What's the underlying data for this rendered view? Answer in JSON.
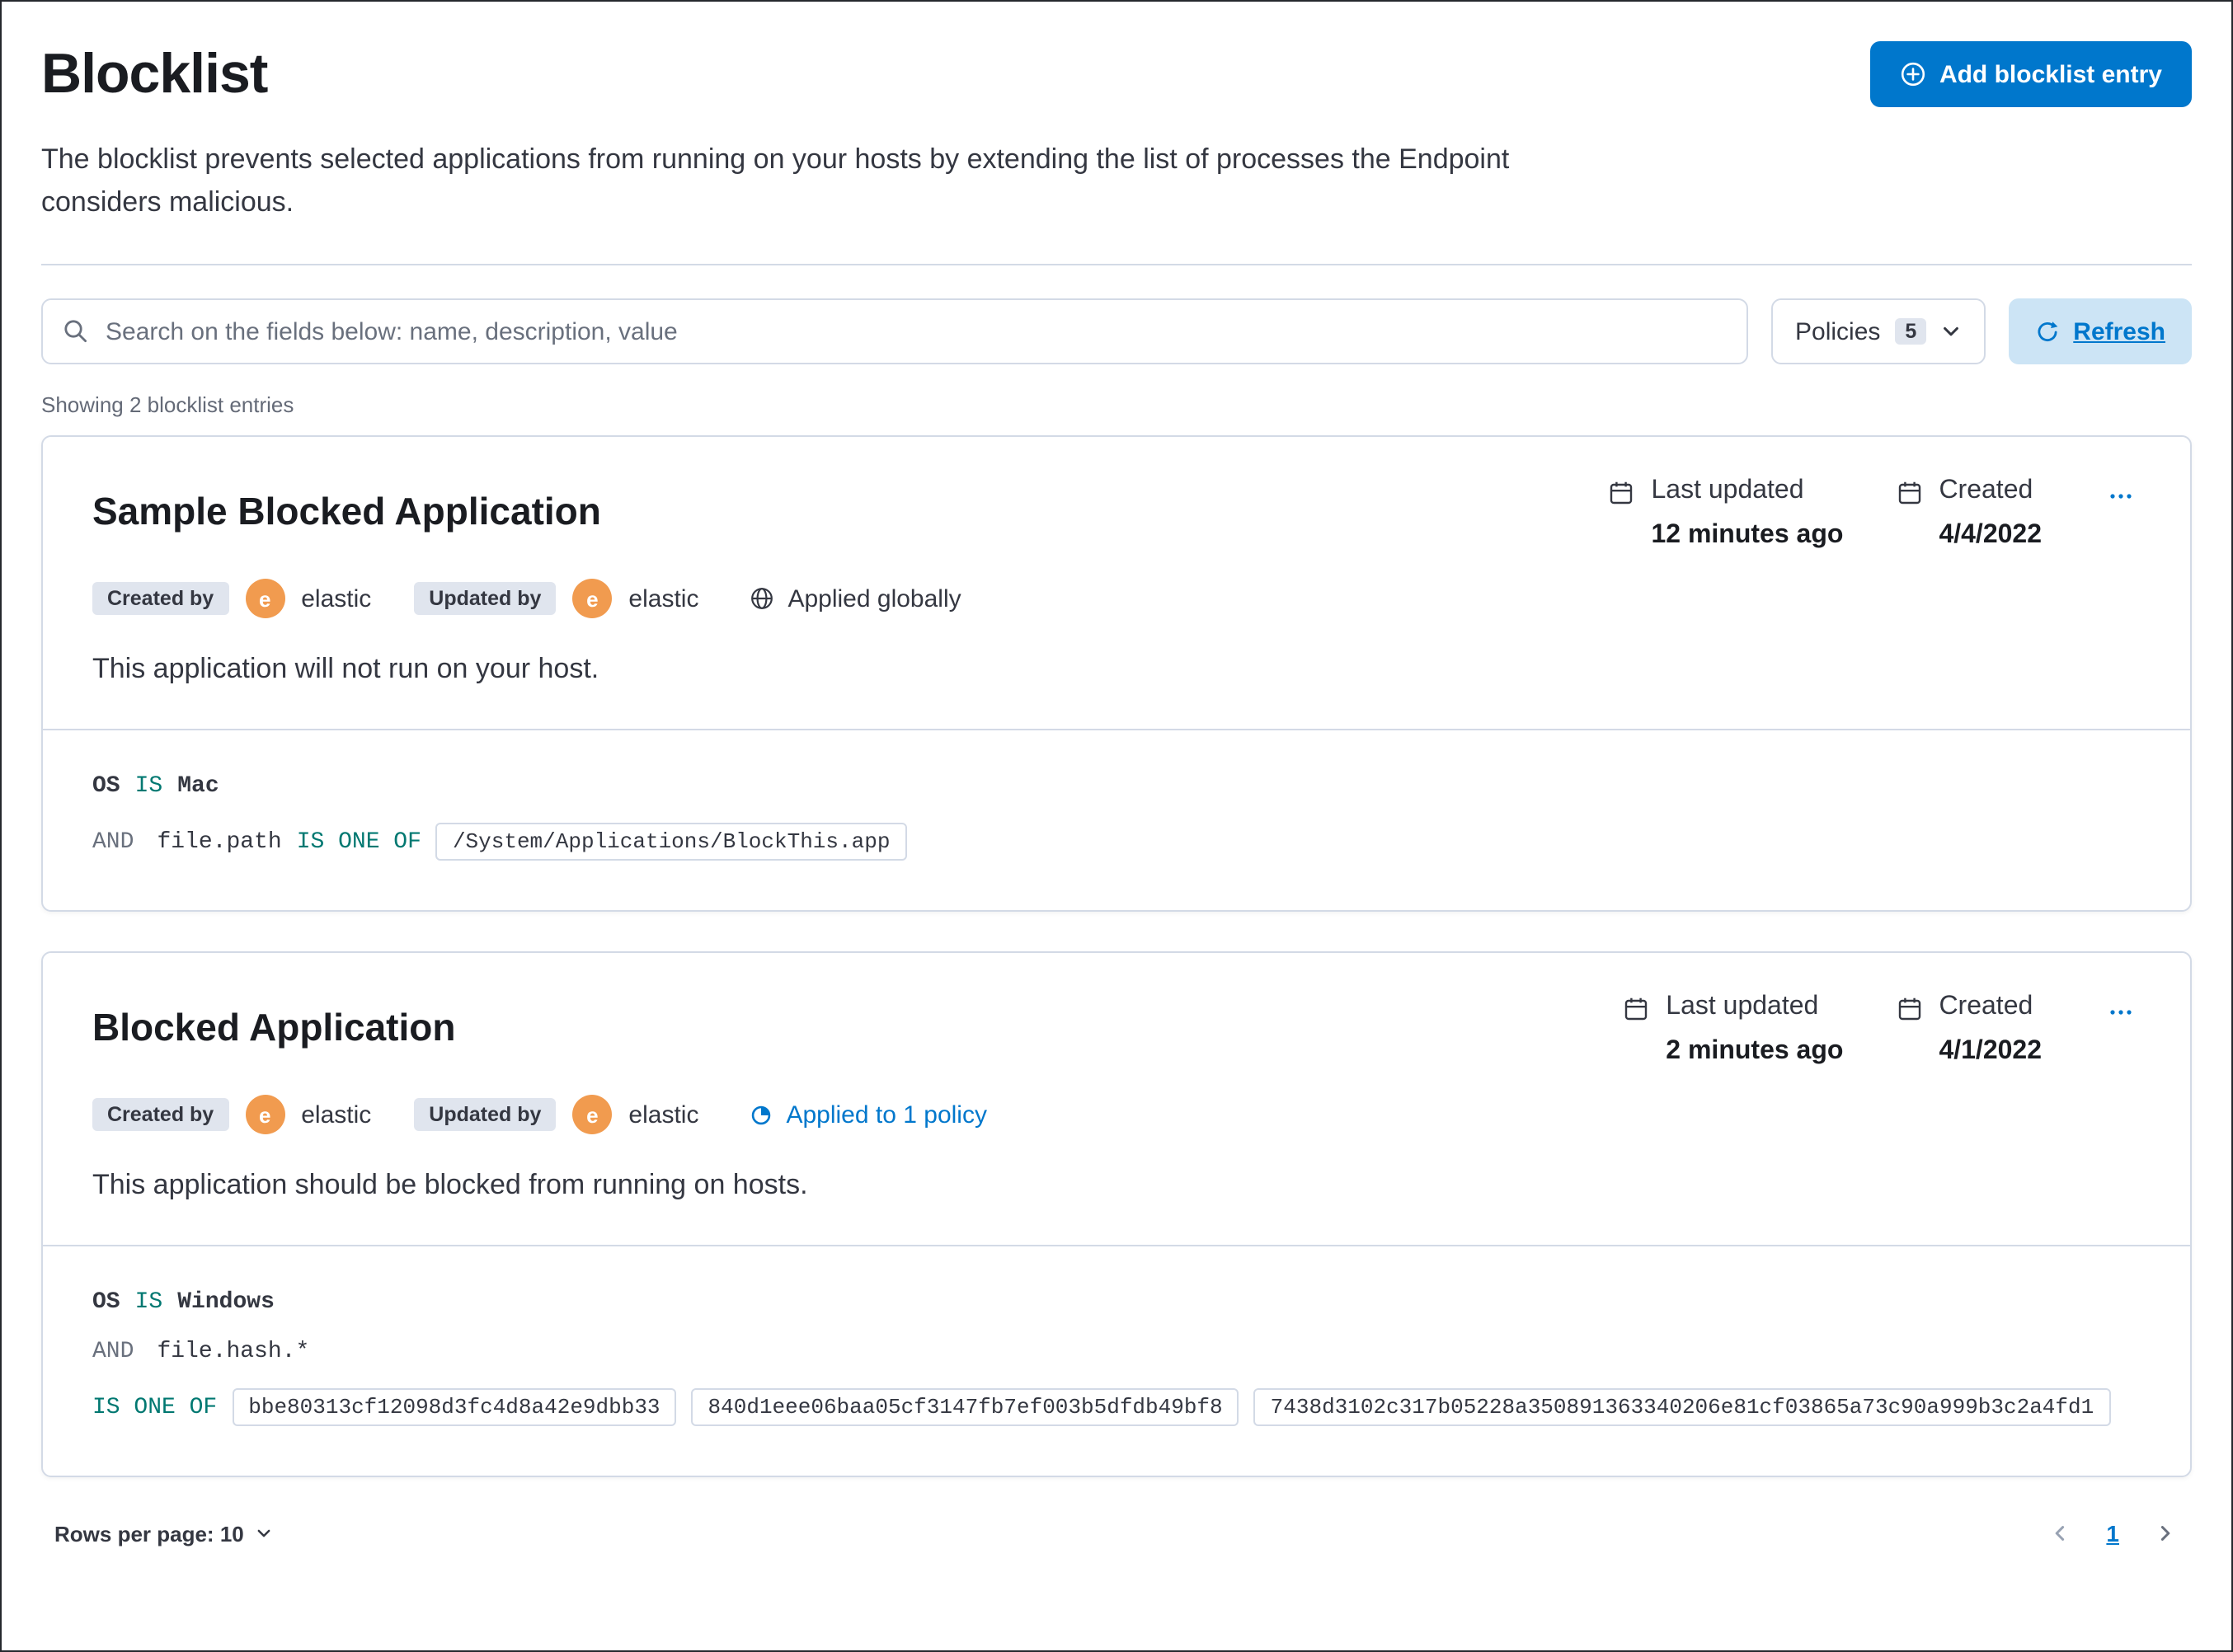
{
  "colors": {
    "primary": "#0077CC",
    "operator_teal": "#007871",
    "avatar_orange": "#F19B4F",
    "badge_gray": "#E0E5EE",
    "refresh_bg": "#CCE4F5"
  },
  "page": {
    "title": "Blocklist",
    "description": "The blocklist prevents selected applications from running on your hosts by extending the list of processes the Endpoint considers malicious.",
    "add_button_label": "Add blocklist entry",
    "search_placeholder": "Search on the fields below: name, description, value",
    "policies_filter": {
      "label": "Policies",
      "count": "5"
    },
    "refresh_label": "Refresh",
    "showing_text": "Showing 2 blocklist entries"
  },
  "entries": [
    {
      "title": "Sample Blocked Application",
      "meta": {
        "last_updated_label": "Last updated",
        "last_updated_value": "12 minutes ago",
        "created_label": "Created",
        "created_value": "4/4/2022"
      },
      "attribution": {
        "created_by_label": "Created by",
        "created_by": "elastic",
        "updated_by_label": "Updated by",
        "updated_by": "elastic",
        "avatar_letter": "e"
      },
      "scope": "Applied globally",
      "description": "This application will not run on your host.",
      "criteria": {
        "os": {
          "field": "OS",
          "operator": "IS",
          "value": "Mac"
        },
        "conditions": [
          {
            "conjunction": "AND",
            "field": "file.path",
            "operator": "IS ONE OF",
            "values": [
              "/System/Applications/BlockThis.app"
            ]
          }
        ]
      }
    },
    {
      "title": "Blocked Application",
      "meta": {
        "last_updated_label": "Last updated",
        "last_updated_value": "2 minutes ago",
        "created_label": "Created",
        "created_value": "4/1/2022"
      },
      "attribution": {
        "created_by_label": "Created by",
        "created_by": "elastic",
        "updated_by_label": "Updated by",
        "updated_by": "elastic",
        "avatar_letter": "e"
      },
      "scope": "Applied to 1 policy",
      "description": "This application should be blocked from running on hosts.",
      "criteria": {
        "os": {
          "field": "OS",
          "operator": "IS",
          "value": "Windows"
        },
        "conditions": [
          {
            "conjunction": "AND",
            "field": "file.hash.*",
            "operator": "IS ONE OF",
            "values": [
              "bbe80313cf12098d3fc4d8a42e9dbb33",
              "840d1eee06baa05cf3147fb7ef003b5dfdb49bf8",
              "7438d3102c317b05228a350891363340206e81cf03865a73c90a999b3c2a4fd1"
            ]
          }
        ]
      }
    }
  ],
  "footer": {
    "rows_per_page_label": "Rows per page: 10",
    "current_page": "1"
  }
}
